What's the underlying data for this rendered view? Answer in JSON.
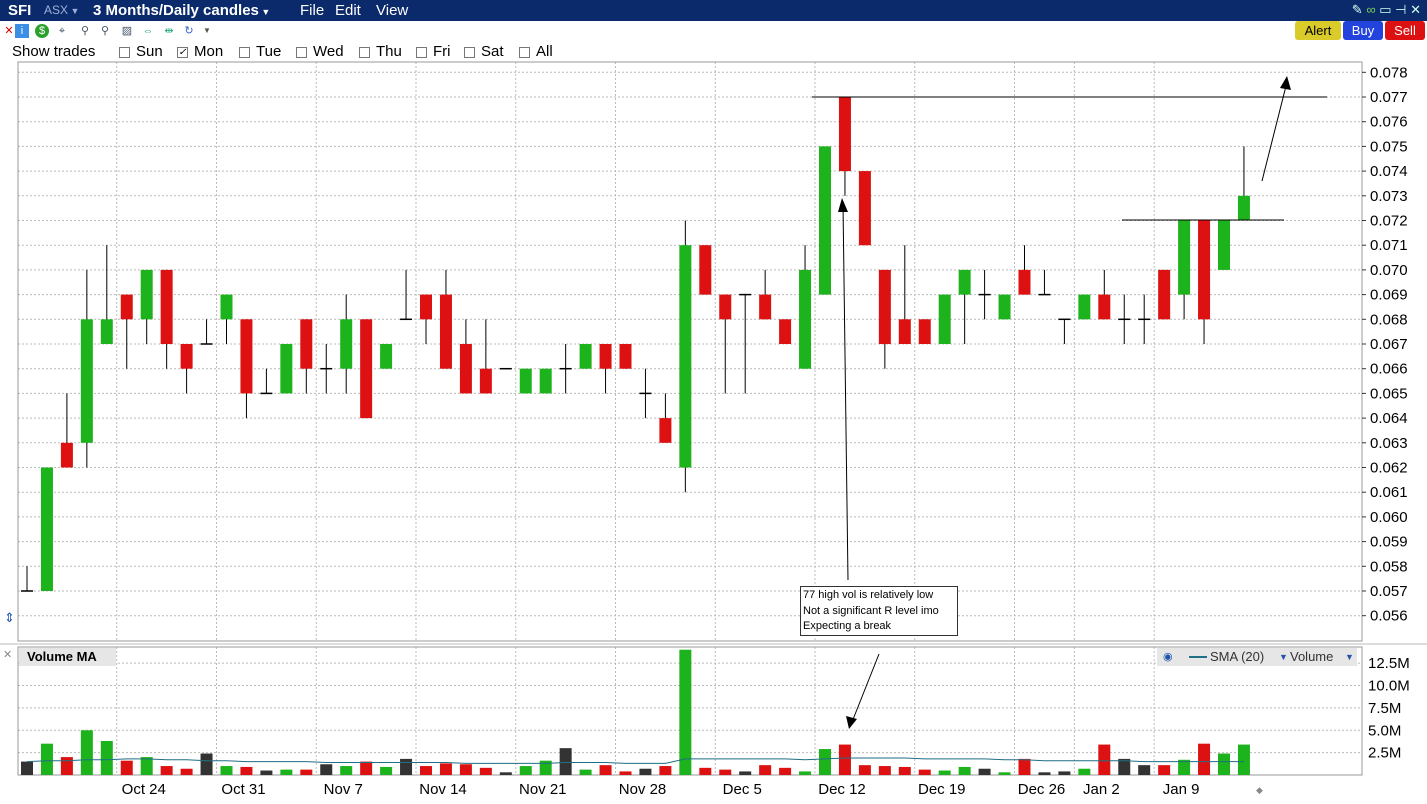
{
  "titlebar": {
    "symbol": "SFI",
    "exchange": "ASX",
    "period": "3 Months/Daily candles",
    "menus": [
      "File",
      "Edit",
      "View"
    ]
  },
  "buttons": {
    "alert": "Alert",
    "buy": "Buy",
    "sell": "Sell"
  },
  "show_trades": {
    "label": "Show trades",
    "days": [
      {
        "label": "Sun",
        "checked": false
      },
      {
        "label": "Mon",
        "checked": true
      },
      {
        "label": "Tue",
        "checked": false
      },
      {
        "label": "Wed",
        "checked": false
      },
      {
        "label": "Thu",
        "checked": false
      },
      {
        "label": "Fri",
        "checked": false
      },
      {
        "label": "Sat",
        "checked": false
      },
      {
        "label": "All",
        "checked": false
      }
    ]
  },
  "annotation": {
    "lines": [
      "77 high vol is relatively low",
      "Not a significant R level imo",
      "Expecting a break"
    ]
  },
  "volume_panel": {
    "title": "Volume MA",
    "legend_sma": "SMA (20)",
    "legend_volume": "Volume"
  },
  "colors": {
    "up": "#1db31d",
    "down": "#dd1111",
    "neutral": "#333333",
    "sma": "#1f6f86",
    "titlebar": "#0b2a6b"
  },
  "chart_data": {
    "type": "candlestick",
    "price_axis": {
      "min": 0.0555,
      "max": 0.0785,
      "ticks": [
        "0.078",
        "0.077",
        "0.076",
        "0.075",
        "0.074",
        "0.073",
        "0.072",
        "0.071",
        "0.070",
        "0.069",
        "0.068",
        "0.067",
        "0.066",
        "0.065",
        "0.064",
        "0.063",
        "0.062",
        "0.061",
        "0.060",
        "0.059",
        "0.058",
        "0.057",
        "0.056"
      ]
    },
    "volume_axis": {
      "max": 14.5,
      "unit": "M",
      "ticks": [
        "12.5M",
        "10.0M",
        "7.5M",
        "5.0M",
        "2.5M"
      ]
    },
    "x_labels": [
      {
        "label": "Oct 24",
        "index": 5
      },
      {
        "label": "Oct 31",
        "index": 10
      },
      {
        "label": "Nov 7",
        "index": 15
      },
      {
        "label": "Nov 14",
        "index": 20
      },
      {
        "label": "Nov 21",
        "index": 25
      },
      {
        "label": "Nov 28",
        "index": 30
      },
      {
        "label": "Dec 5",
        "index": 35
      },
      {
        "label": "Dec 12",
        "index": 40
      },
      {
        "label": "Dec 19",
        "index": 45
      },
      {
        "label": "Dec 26",
        "index": 50
      },
      {
        "label": "Jan 2",
        "index": 53
      },
      {
        "label": "Jan 9",
        "index": 57
      }
    ],
    "candles": [
      {
        "o": 0.057,
        "h": 0.058,
        "l": 0.057,
        "c": 0.057,
        "v": 1.5
      },
      {
        "o": 0.057,
        "h": 0.062,
        "l": 0.057,
        "c": 0.062,
        "v": 3.5
      },
      {
        "o": 0.063,
        "h": 0.065,
        "l": 0.062,
        "c": 0.062,
        "v": 2.0
      },
      {
        "o": 0.063,
        "h": 0.07,
        "l": 0.062,
        "c": 0.068,
        "v": 5.0
      },
      {
        "o": 0.067,
        "h": 0.071,
        "l": 0.067,
        "c": 0.068,
        "v": 3.8
      },
      {
        "o": 0.069,
        "h": 0.069,
        "l": 0.066,
        "c": 0.068,
        "v": 1.6
      },
      {
        "o": 0.068,
        "h": 0.07,
        "l": 0.067,
        "c": 0.07,
        "v": 2.0
      },
      {
        "o": 0.07,
        "h": 0.07,
        "l": 0.066,
        "c": 0.067,
        "v": 1.0
      },
      {
        "o": 0.067,
        "h": 0.067,
        "l": 0.065,
        "c": 0.066,
        "v": 0.7
      },
      {
        "o": 0.067,
        "h": 0.068,
        "l": 0.067,
        "c": 0.067,
        "v": 2.4
      },
      {
        "o": 0.068,
        "h": 0.069,
        "l": 0.067,
        "c": 0.069,
        "v": 1.0
      },
      {
        "o": 0.068,
        "h": 0.068,
        "l": 0.064,
        "c": 0.065,
        "v": 0.9
      },
      {
        "o": 0.065,
        "h": 0.066,
        "l": 0.065,
        "c": 0.065,
        "v": 0.5
      },
      {
        "o": 0.065,
        "h": 0.067,
        "l": 0.065,
        "c": 0.067,
        "v": 0.6
      },
      {
        "o": 0.068,
        "h": 0.068,
        "l": 0.065,
        "c": 0.066,
        "v": 0.6
      },
      {
        "o": 0.066,
        "h": 0.067,
        "l": 0.065,
        "c": 0.066,
        "v": 1.2
      },
      {
        "o": 0.066,
        "h": 0.069,
        "l": 0.065,
        "c": 0.068,
        "v": 1.0
      },
      {
        "o": 0.068,
        "h": 0.068,
        "l": 0.064,
        "c": 0.064,
        "v": 1.5
      },
      {
        "o": 0.066,
        "h": 0.067,
        "l": 0.066,
        "c": 0.067,
        "v": 0.9
      },
      {
        "o": 0.068,
        "h": 0.07,
        "l": 0.068,
        "c": 0.068,
        "v": 1.8
      },
      {
        "o": 0.069,
        "h": 0.069,
        "l": 0.067,
        "c": 0.068,
        "v": 1.0
      },
      {
        "o": 0.069,
        "h": 0.07,
        "l": 0.066,
        "c": 0.066,
        "v": 1.3
      },
      {
        "o": 0.067,
        "h": 0.068,
        "l": 0.065,
        "c": 0.065,
        "v": 1.2
      },
      {
        "o": 0.066,
        "h": 0.068,
        "l": 0.065,
        "c": 0.065,
        "v": 0.8
      },
      {
        "o": 0.066,
        "h": 0.066,
        "l": 0.066,
        "c": 0.066,
        "v": 0.3
      },
      {
        "o": 0.065,
        "h": 0.066,
        "l": 0.065,
        "c": 0.066,
        "v": 1.0
      },
      {
        "o": 0.065,
        "h": 0.066,
        "l": 0.065,
        "c": 0.066,
        "v": 1.6
      },
      {
        "o": 0.066,
        "h": 0.067,
        "l": 0.065,
        "c": 0.066,
        "v": 3.0
      },
      {
        "o": 0.066,
        "h": 0.067,
        "l": 0.066,
        "c": 0.067,
        "v": 0.6
      },
      {
        "o": 0.067,
        "h": 0.067,
        "l": 0.065,
        "c": 0.066,
        "v": 1.1
      },
      {
        "o": 0.067,
        "h": 0.067,
        "l": 0.066,
        "c": 0.066,
        "v": 0.4
      },
      {
        "o": 0.065,
        "h": 0.066,
        "l": 0.064,
        "c": 0.065,
        "v": 0.7
      },
      {
        "o": 0.064,
        "h": 0.065,
        "l": 0.063,
        "c": 0.063,
        "v": 1.0
      },
      {
        "o": 0.062,
        "h": 0.072,
        "l": 0.061,
        "c": 0.071,
        "v": 14.0
      },
      {
        "o": 0.071,
        "h": 0.071,
        "l": 0.069,
        "c": 0.069,
        "v": 0.8
      },
      {
        "o": 0.069,
        "h": 0.069,
        "l": 0.065,
        "c": 0.068,
        "v": 0.6
      },
      {
        "o": 0.069,
        "h": 0.069,
        "l": 0.065,
        "c": 0.069,
        "v": 0.4
      },
      {
        "o": 0.069,
        "h": 0.07,
        "l": 0.068,
        "c": 0.068,
        "v": 1.1
      },
      {
        "o": 0.068,
        "h": 0.068,
        "l": 0.067,
        "c": 0.067,
        "v": 0.8
      },
      {
        "o": 0.066,
        "h": 0.071,
        "l": 0.066,
        "c": 0.07,
        "v": 0.4
      },
      {
        "o": 0.069,
        "h": 0.075,
        "l": 0.069,
        "c": 0.075,
        "v": 2.9
      },
      {
        "o": 0.077,
        "h": 0.077,
        "l": 0.073,
        "c": 0.074,
        "v": 3.4
      },
      {
        "o": 0.074,
        "h": 0.074,
        "l": 0.071,
        "c": 0.071,
        "v": 1.1
      },
      {
        "o": 0.07,
        "h": 0.07,
        "l": 0.066,
        "c": 0.067,
        "v": 1.0
      },
      {
        "o": 0.068,
        "h": 0.071,
        "l": 0.067,
        "c": 0.067,
        "v": 0.9
      },
      {
        "o": 0.068,
        "h": 0.068,
        "l": 0.067,
        "c": 0.067,
        "v": 0.6
      },
      {
        "o": 0.067,
        "h": 0.069,
        "l": 0.067,
        "c": 0.069,
        "v": 0.5
      },
      {
        "o": 0.069,
        "h": 0.07,
        "l": 0.067,
        "c": 0.07,
        "v": 0.9
      },
      {
        "o": 0.069,
        "h": 0.07,
        "l": 0.068,
        "c": 0.069,
        "v": 0.7
      },
      {
        "o": 0.068,
        "h": 0.069,
        "l": 0.068,
        "c": 0.069,
        "v": 0.3
      },
      {
        "o": 0.07,
        "h": 0.071,
        "l": 0.069,
        "c": 0.069,
        "v": 1.8
      },
      {
        "o": 0.069,
        "h": 0.07,
        "l": 0.069,
        "c": 0.069,
        "v": 0.3
      },
      {
        "o": 0.068,
        "h": 0.068,
        "l": 0.067,
        "c": 0.068,
        "v": 0.4
      },
      {
        "o": 0.068,
        "h": 0.069,
        "l": 0.068,
        "c": 0.069,
        "v": 0.7
      },
      {
        "o": 0.069,
        "h": 0.07,
        "l": 0.068,
        "c": 0.068,
        "v": 3.4
      },
      {
        "o": 0.068,
        "h": 0.069,
        "l": 0.067,
        "c": 0.068,
        "v": 1.8
      },
      {
        "o": 0.068,
        "h": 0.069,
        "l": 0.067,
        "c": 0.068,
        "v": 1.1
      },
      {
        "o": 0.07,
        "h": 0.07,
        "l": 0.068,
        "c": 0.068,
        "v": 1.1
      },
      {
        "o": 0.069,
        "h": 0.072,
        "l": 0.068,
        "c": 0.072,
        "v": 1.7
      },
      {
        "o": 0.072,
        "h": 0.072,
        "l": 0.067,
        "c": 0.068,
        "v": 3.5
      },
      {
        "o": 0.07,
        "h": 0.072,
        "l": 0.07,
        "c": 0.072,
        "v": 2.4
      },
      {
        "o": 0.072,
        "h": 0.075,
        "l": 0.072,
        "c": 0.073,
        "v": 3.4
      }
    ],
    "sma20": [
      1.5,
      1.6,
      1.6,
      1.7,
      1.7,
      1.8,
      1.8,
      1.7,
      1.7,
      1.6,
      1.6,
      1.5,
      1.5,
      1.5,
      1.5,
      1.4,
      1.4,
      1.4,
      1.4,
      1.4,
      1.4,
      1.4,
      1.3,
      1.3,
      1.3,
      1.3,
      1.3,
      1.4,
      1.4,
      1.4,
      1.3,
      1.3,
      1.3,
      1.8,
      1.8,
      1.8,
      1.8,
      1.8,
      1.8,
      1.7,
      1.8,
      1.9,
      1.9,
      1.9,
      1.9,
      1.8,
      1.8,
      1.8,
      1.8,
      1.7,
      1.7,
      1.6,
      1.6,
      1.6,
      1.6,
      1.6,
      1.5,
      1.5,
      1.5,
      1.5,
      1.5,
      1.5
    ]
  }
}
